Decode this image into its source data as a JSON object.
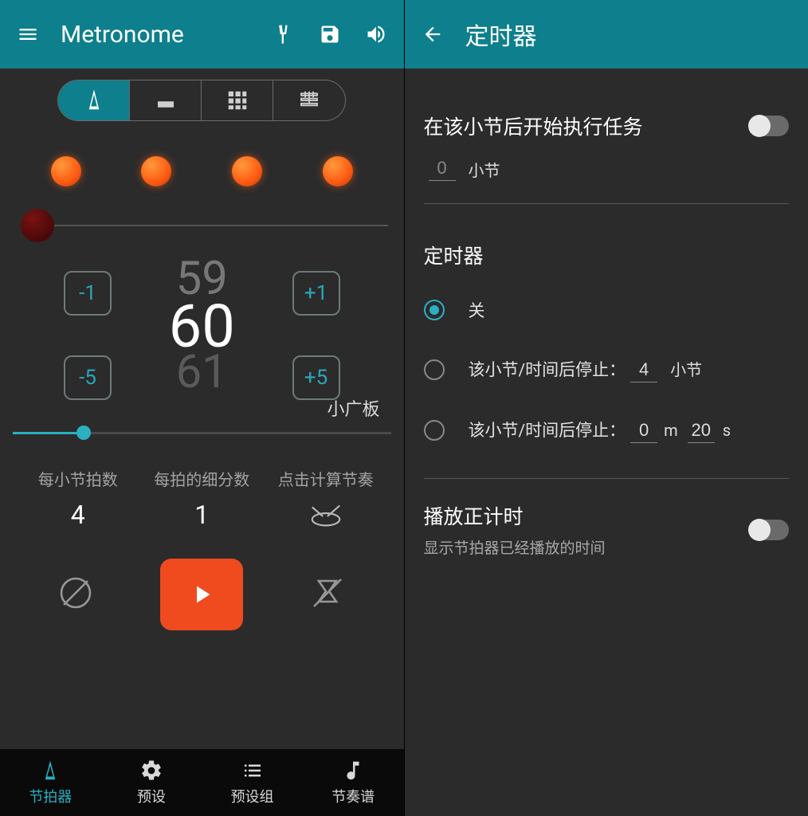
{
  "left": {
    "title": "Metronome",
    "mode_tabs": [
      "metronome",
      "drums",
      "pads",
      "tracks"
    ],
    "beat_count": 4,
    "bpm_prev": "59",
    "bpm_current": "60",
    "bpm_next": "61",
    "btn_minus1": "-1",
    "btn_plus1": "+1",
    "btn_minus5": "-5",
    "btn_plus5": "+5",
    "tempo_name": "小广板",
    "beats_per_bar": {
      "label": "每小节拍数",
      "value": "4"
    },
    "subdivision": {
      "label": "每拍的细分数",
      "value": "1"
    },
    "tap_tempo": {
      "label": "点击计算节奏"
    },
    "nav": [
      {
        "label": "节拍器"
      },
      {
        "label": "预设"
      },
      {
        "label": "预设组"
      },
      {
        "label": "节奏谱"
      }
    ]
  },
  "right": {
    "title": "定时器",
    "start_after": {
      "label": "在该小节后开始执行任务",
      "value": "0",
      "unit": "小节"
    },
    "timer_section": "定时器",
    "opt_off": "关",
    "opt_bars": {
      "text": "该小节/时间后停止：",
      "value": "4",
      "unit": "小节"
    },
    "opt_time": {
      "text": "该小节/时间后停止：",
      "m": "0",
      "m_unit": "m",
      "s": "20",
      "s_unit": "s"
    },
    "elapsed": {
      "title": "播放正计时",
      "sub": "显示节拍器已经播放的时间"
    }
  }
}
